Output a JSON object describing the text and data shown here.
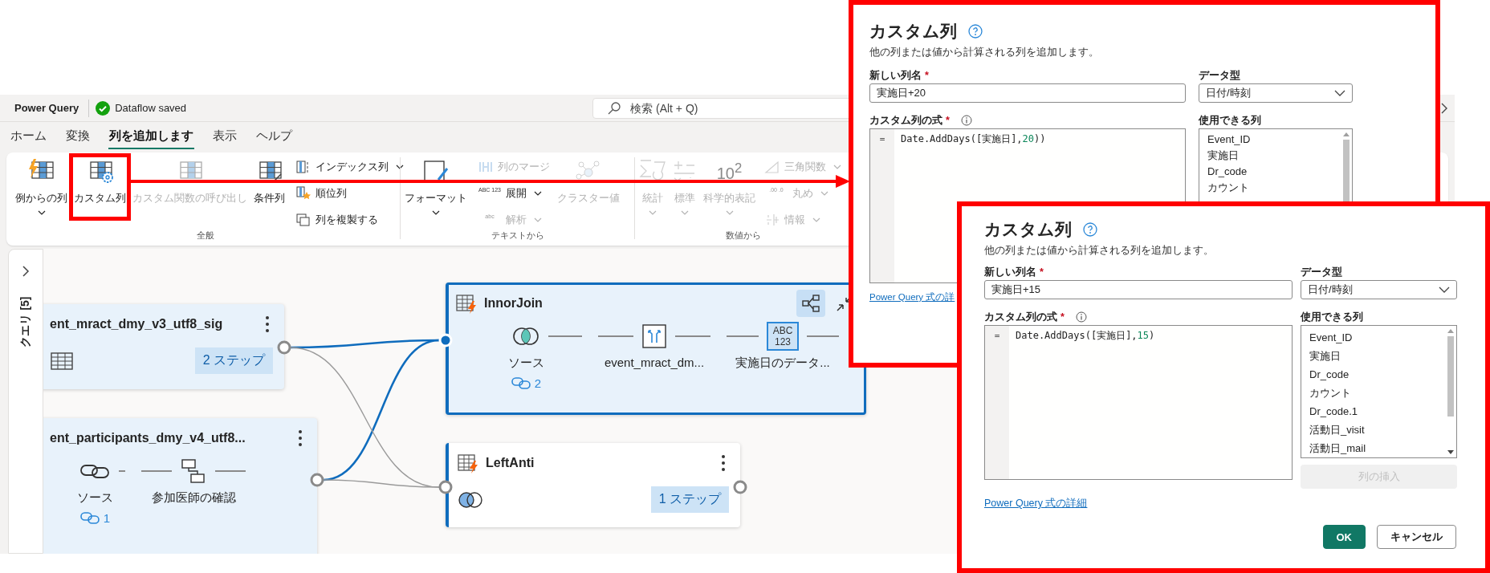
{
  "app": {
    "title": "Power Query",
    "status": "Dataflow saved",
    "search_placeholder": "検索 (Alt + Q)"
  },
  "tabs": [
    {
      "label": "ホーム",
      "selected": false
    },
    {
      "label": "変換",
      "selected": false
    },
    {
      "label": "列を追加します",
      "selected": true
    },
    {
      "label": "表示",
      "selected": false
    },
    {
      "label": "ヘルプ",
      "selected": false
    }
  ],
  "ribbon": [
    {
      "label": "全般",
      "items": [
        {
          "kind": "large",
          "label": "例からの列",
          "dropdown": true,
          "disabled": false,
          "highlighted": false
        },
        {
          "kind": "large",
          "label": "カスタム列",
          "dropdown": false,
          "disabled": false,
          "highlighted": true
        },
        {
          "kind": "large",
          "label": "カスタム関数の呼び出し",
          "dropdown": false,
          "disabled": true,
          "highlighted": false
        },
        {
          "kind": "large",
          "label": "条件列",
          "dropdown": false,
          "disabled": false,
          "highlighted": false
        },
        {
          "kind": "stack",
          "items": [
            {
              "label": "インデックス列",
              "dropdown": true,
              "disabled": false
            },
            {
              "label": "順位列",
              "dropdown": false,
              "disabled": false
            },
            {
              "label": "列を複製する",
              "dropdown": false,
              "disabled": false
            }
          ]
        }
      ]
    },
    {
      "label": "テキストから",
      "items": [
        {
          "kind": "large",
          "label": "フォーマット",
          "dropdown": true,
          "disabled": false,
          "highlighted": false
        },
        {
          "kind": "stack",
          "items": [
            {
              "label": "列のマージ",
              "dropdown": false,
              "disabled": true
            },
            {
              "label": "展開",
              "dropdown": true,
              "disabled": false,
              "icon_text": "ABC 123"
            },
            {
              "label": "解析",
              "dropdown": true,
              "disabled": true,
              "icon_text": "abc"
            }
          ]
        },
        {
          "kind": "large",
          "label": "クラスター値",
          "dropdown": false,
          "disabled": true,
          "highlighted": false
        }
      ]
    },
    {
      "label": "数値から",
      "items": [
        {
          "kind": "large",
          "label": "統計",
          "dropdown": true,
          "disabled": true,
          "highlighted": false
        },
        {
          "kind": "large",
          "label": "標準",
          "dropdown": true,
          "disabled": true,
          "highlighted": false
        },
        {
          "kind": "large",
          "label": "科学的表記",
          "dropdown": true,
          "disabled": true,
          "highlighted": false,
          "icon_text": "10$^{2}$"
        },
        {
          "kind": "stack",
          "items": [
            {
              "label": "三角関数",
              "dropdown": true,
              "disabled": true
            },
            {
              "label": "丸め",
              "dropdown": true,
              "disabled": true,
              "icon_text": ".00 .0"
            },
            {
              "label": "情報",
              "dropdown": true,
              "disabled": true
            }
          ]
        }
      ]
    }
  ],
  "queries_panel": {
    "label": "クエリ [5]"
  },
  "diagram": {
    "nodes": [
      {
        "title": "ent_mract_dmy_v3_utf8_sig",
        "kind": "collapsed",
        "selected": false,
        "highlighted": true,
        "steps_badge": "2 ステップ"
      },
      {
        "title": "ent_participants_dmy_v4_utf8...",
        "kind": "expanded",
        "selected": false,
        "highlighted": true,
        "steps": [
          {
            "label": "ソース",
            "links": "1"
          },
          {
            "label": "参加医師の確認"
          }
        ]
      },
      {
        "title": "InnorJoin",
        "kind": "expanded",
        "selected": true,
        "highlighted": true,
        "steps": [
          {
            "label": "ソース",
            "links": "2"
          },
          {
            "label": "event_mract_dm..."
          },
          {
            "label": "実施日のデータ...",
            "icon_text": "ABC 123"
          }
        ]
      },
      {
        "title": "LeftAnti",
        "kind": "collapsed",
        "selected": false,
        "highlighted": false,
        "steps_badge": "1 ステップ"
      }
    ]
  },
  "dialogs": [
    {
      "title": "カスタム列",
      "description": "他の列または値から計算される列を追加します。",
      "name_field": {
        "label": "新しい列名",
        "required": "*",
        "value": "実施日+20"
      },
      "type_field": {
        "label": "データ型",
        "value": "日付/時刻"
      },
      "formula_field": {
        "label": "カスタム列の式",
        "required": "*",
        "gutter": "=",
        "tokens": [
          {
            "kind": "code",
            "text": "Date.AddDays([実施日],"
          },
          {
            "kind": "number",
            "text": "20"
          },
          {
            "kind": "code",
            "text": "))"
          }
        ]
      },
      "columns_label": "使用できる列",
      "columns": [
        "Event_ID",
        "実施日",
        "Dr_code",
        "カウント"
      ],
      "link": "Power Query 式の詳"
    },
    {
      "title": "カスタム列",
      "description": "他の列または値から計算される列を追加します。",
      "name_field": {
        "label": "新しい列名",
        "required": "*",
        "value": "実施日+15"
      },
      "type_field": {
        "label": "データ型",
        "value": "日付/時刻"
      },
      "formula_field": {
        "label": "カスタム列の式",
        "required": "*",
        "gutter": "=",
        "tokens": [
          {
            "kind": "code",
            "text": "Date.AddDays([実施日],"
          },
          {
            "kind": "number",
            "text": "15"
          },
          {
            "kind": "code",
            "text": ")"
          }
        ]
      },
      "columns_label": "使用できる列",
      "columns": [
        "Event_ID",
        "実施日",
        "Dr_code",
        "カウント",
        "Dr_code.1",
        "活動日_visit",
        "活動日_mail"
      ],
      "insert_button": {
        "label": "列の挿入",
        "disabled": true
      },
      "link": "Power Query 式の詳細",
      "buttons": [
        {
          "label": "OK",
          "kind": "primary"
        },
        {
          "label": "キャンセル",
          "kind": "secondary"
        }
      ]
    }
  ]
}
